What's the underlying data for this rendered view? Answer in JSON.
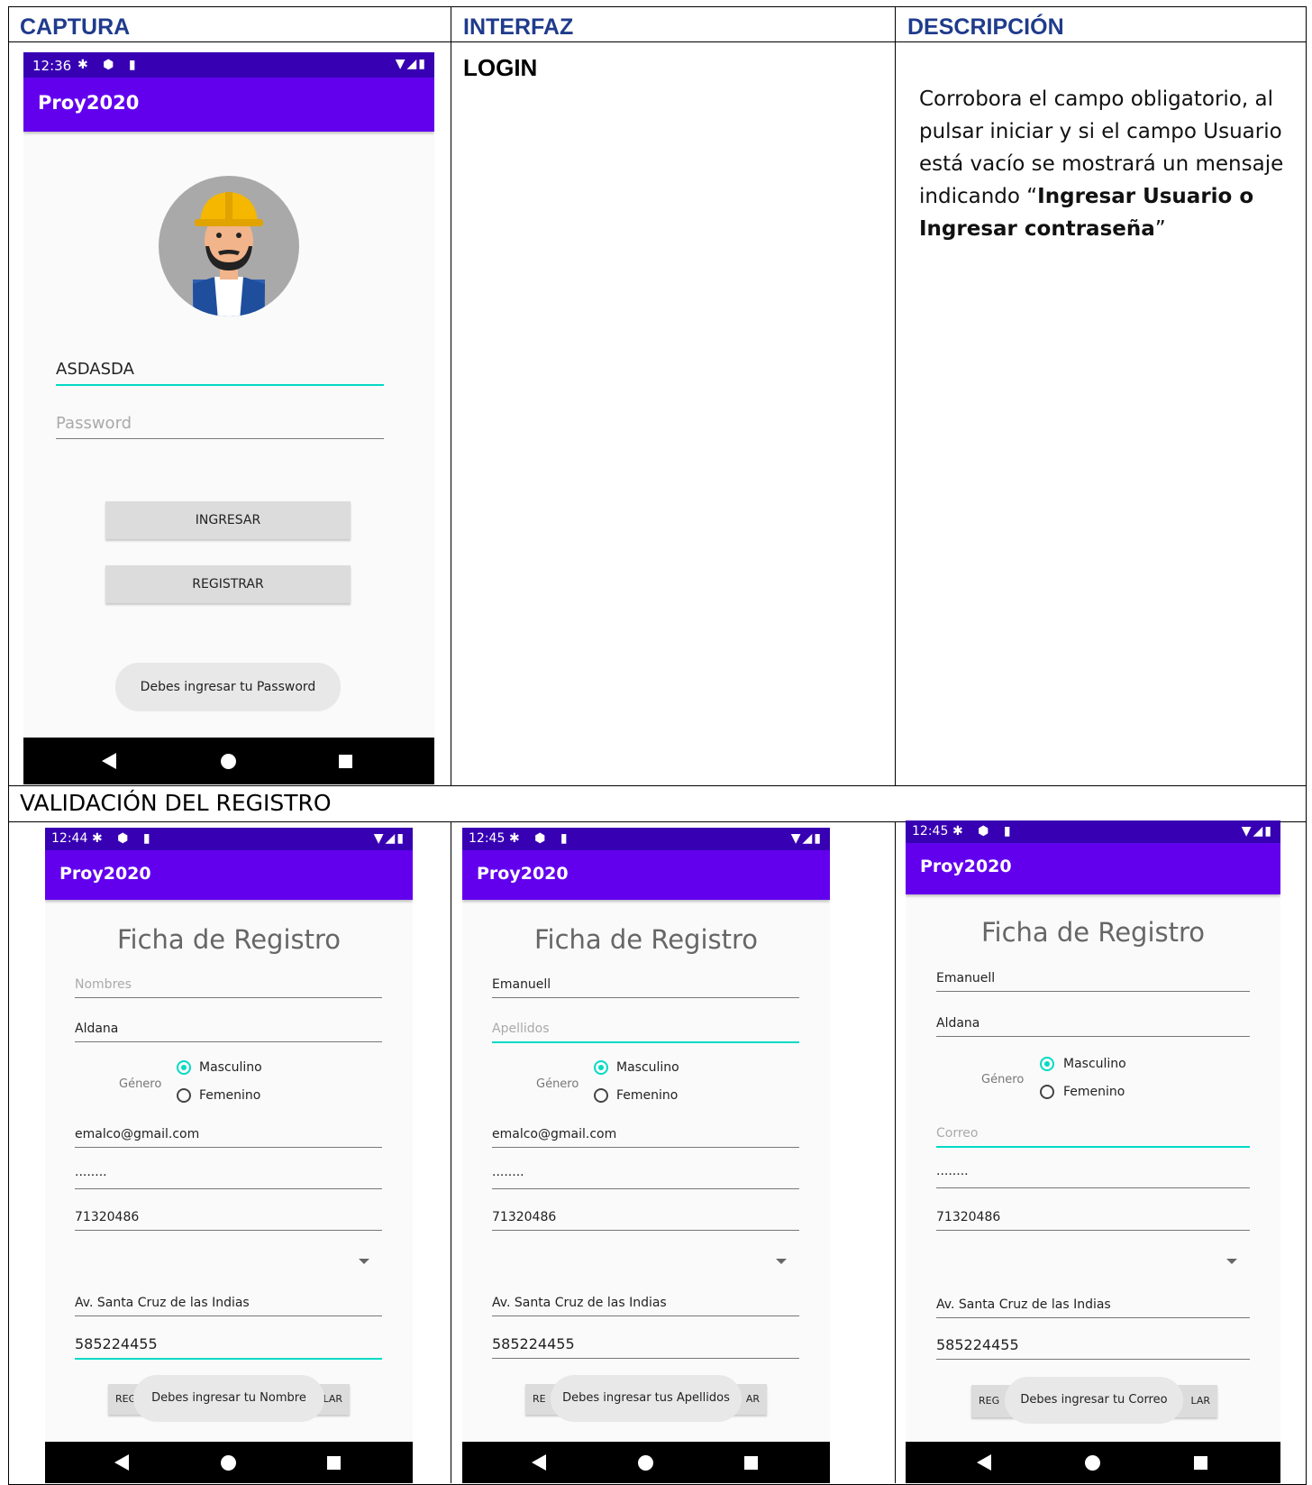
{
  "table": {
    "headers": {
      "captura": "CAPTURA",
      "interfaz": "INTERFAZ",
      "descripcion": "DESCRIPCIÓN"
    },
    "interface_name": "LOGIN",
    "description": {
      "part1": " Corrobora el campo obligatorio, al pulsar iniciar y si el campo Usuario está vacío se mostrará un mensaje indicando “",
      "bold": "Ingresar Usuario o Ingresar contraseña",
      "part2": "”"
    },
    "section2_title": "VALIDACIÓN DEL REGISTRO"
  },
  "login_phone": {
    "time": "12:36",
    "app_title": "Proy2020",
    "username_value": "ASDASDA",
    "password_placeholder": "Password",
    "ingresar_label": "INGRESAR",
    "registrar_label": "REGISTRAR",
    "toast": "Debes ingresar tu Password"
  },
  "reg_phones": [
    {
      "time": "12:44",
      "app_title": "Proy2020",
      "form_title": "Ficha de Registro",
      "nombres": "Nombres",
      "apellidos": "Aldana",
      "genero": "Género",
      "masculino": "Masculino",
      "femenino": "Femenino",
      "correo": "emalco@gmail.com",
      "password": "········",
      "telefono": "71320486",
      "direccion": "Av. Santa Cruz de las Indias",
      "celular": "585224455",
      "btn_left": "REG",
      "btn_right": "LAR",
      "toast": "Debes ingresar tu Nombre"
    },
    {
      "time": "12:45",
      "app_title": "Proy2020",
      "form_title": "Ficha de Registro",
      "nombres": "Emanuell",
      "apellidos": "Apellidos",
      "genero": "Género",
      "masculino": "Masculino",
      "femenino": "Femenino",
      "correo": "emalco@gmail.com",
      "password": "········",
      "telefono": "71320486",
      "direccion": "Av. Santa Cruz de las Indias",
      "celular": "585224455",
      "btn_left": "RE",
      "btn_right": "AR",
      "toast": "Debes ingresar tus Apellidos"
    },
    {
      "time": "12:45",
      "app_title": "Proy2020",
      "form_title": "Ficha de Registro",
      "nombres": "Emanuell",
      "apellidos": "Aldana",
      "genero": "Género",
      "masculino": "Masculino",
      "femenino": "Femenino",
      "correo": "Correo",
      "password": "········",
      "telefono": "71320486",
      "direccion": "Av. Santa Cruz de las Indias",
      "celular": "585224455",
      "btn_left": "REG",
      "btn_right": "LAR",
      "toast": "Debes ingresar tu Correo"
    }
  ],
  "icons": {
    "status_left": "settings-icon, shield-icon, sd-card-icon",
    "status_right": "wifi-icon, signal-icon, battery-icon",
    "nav": "back-icon, home-icon, recents-icon"
  },
  "colors": {
    "status_bar": "#3700b3",
    "app_bar": "#6200ee",
    "accent": "#03dac5",
    "header_text": "#1f3b8c"
  }
}
